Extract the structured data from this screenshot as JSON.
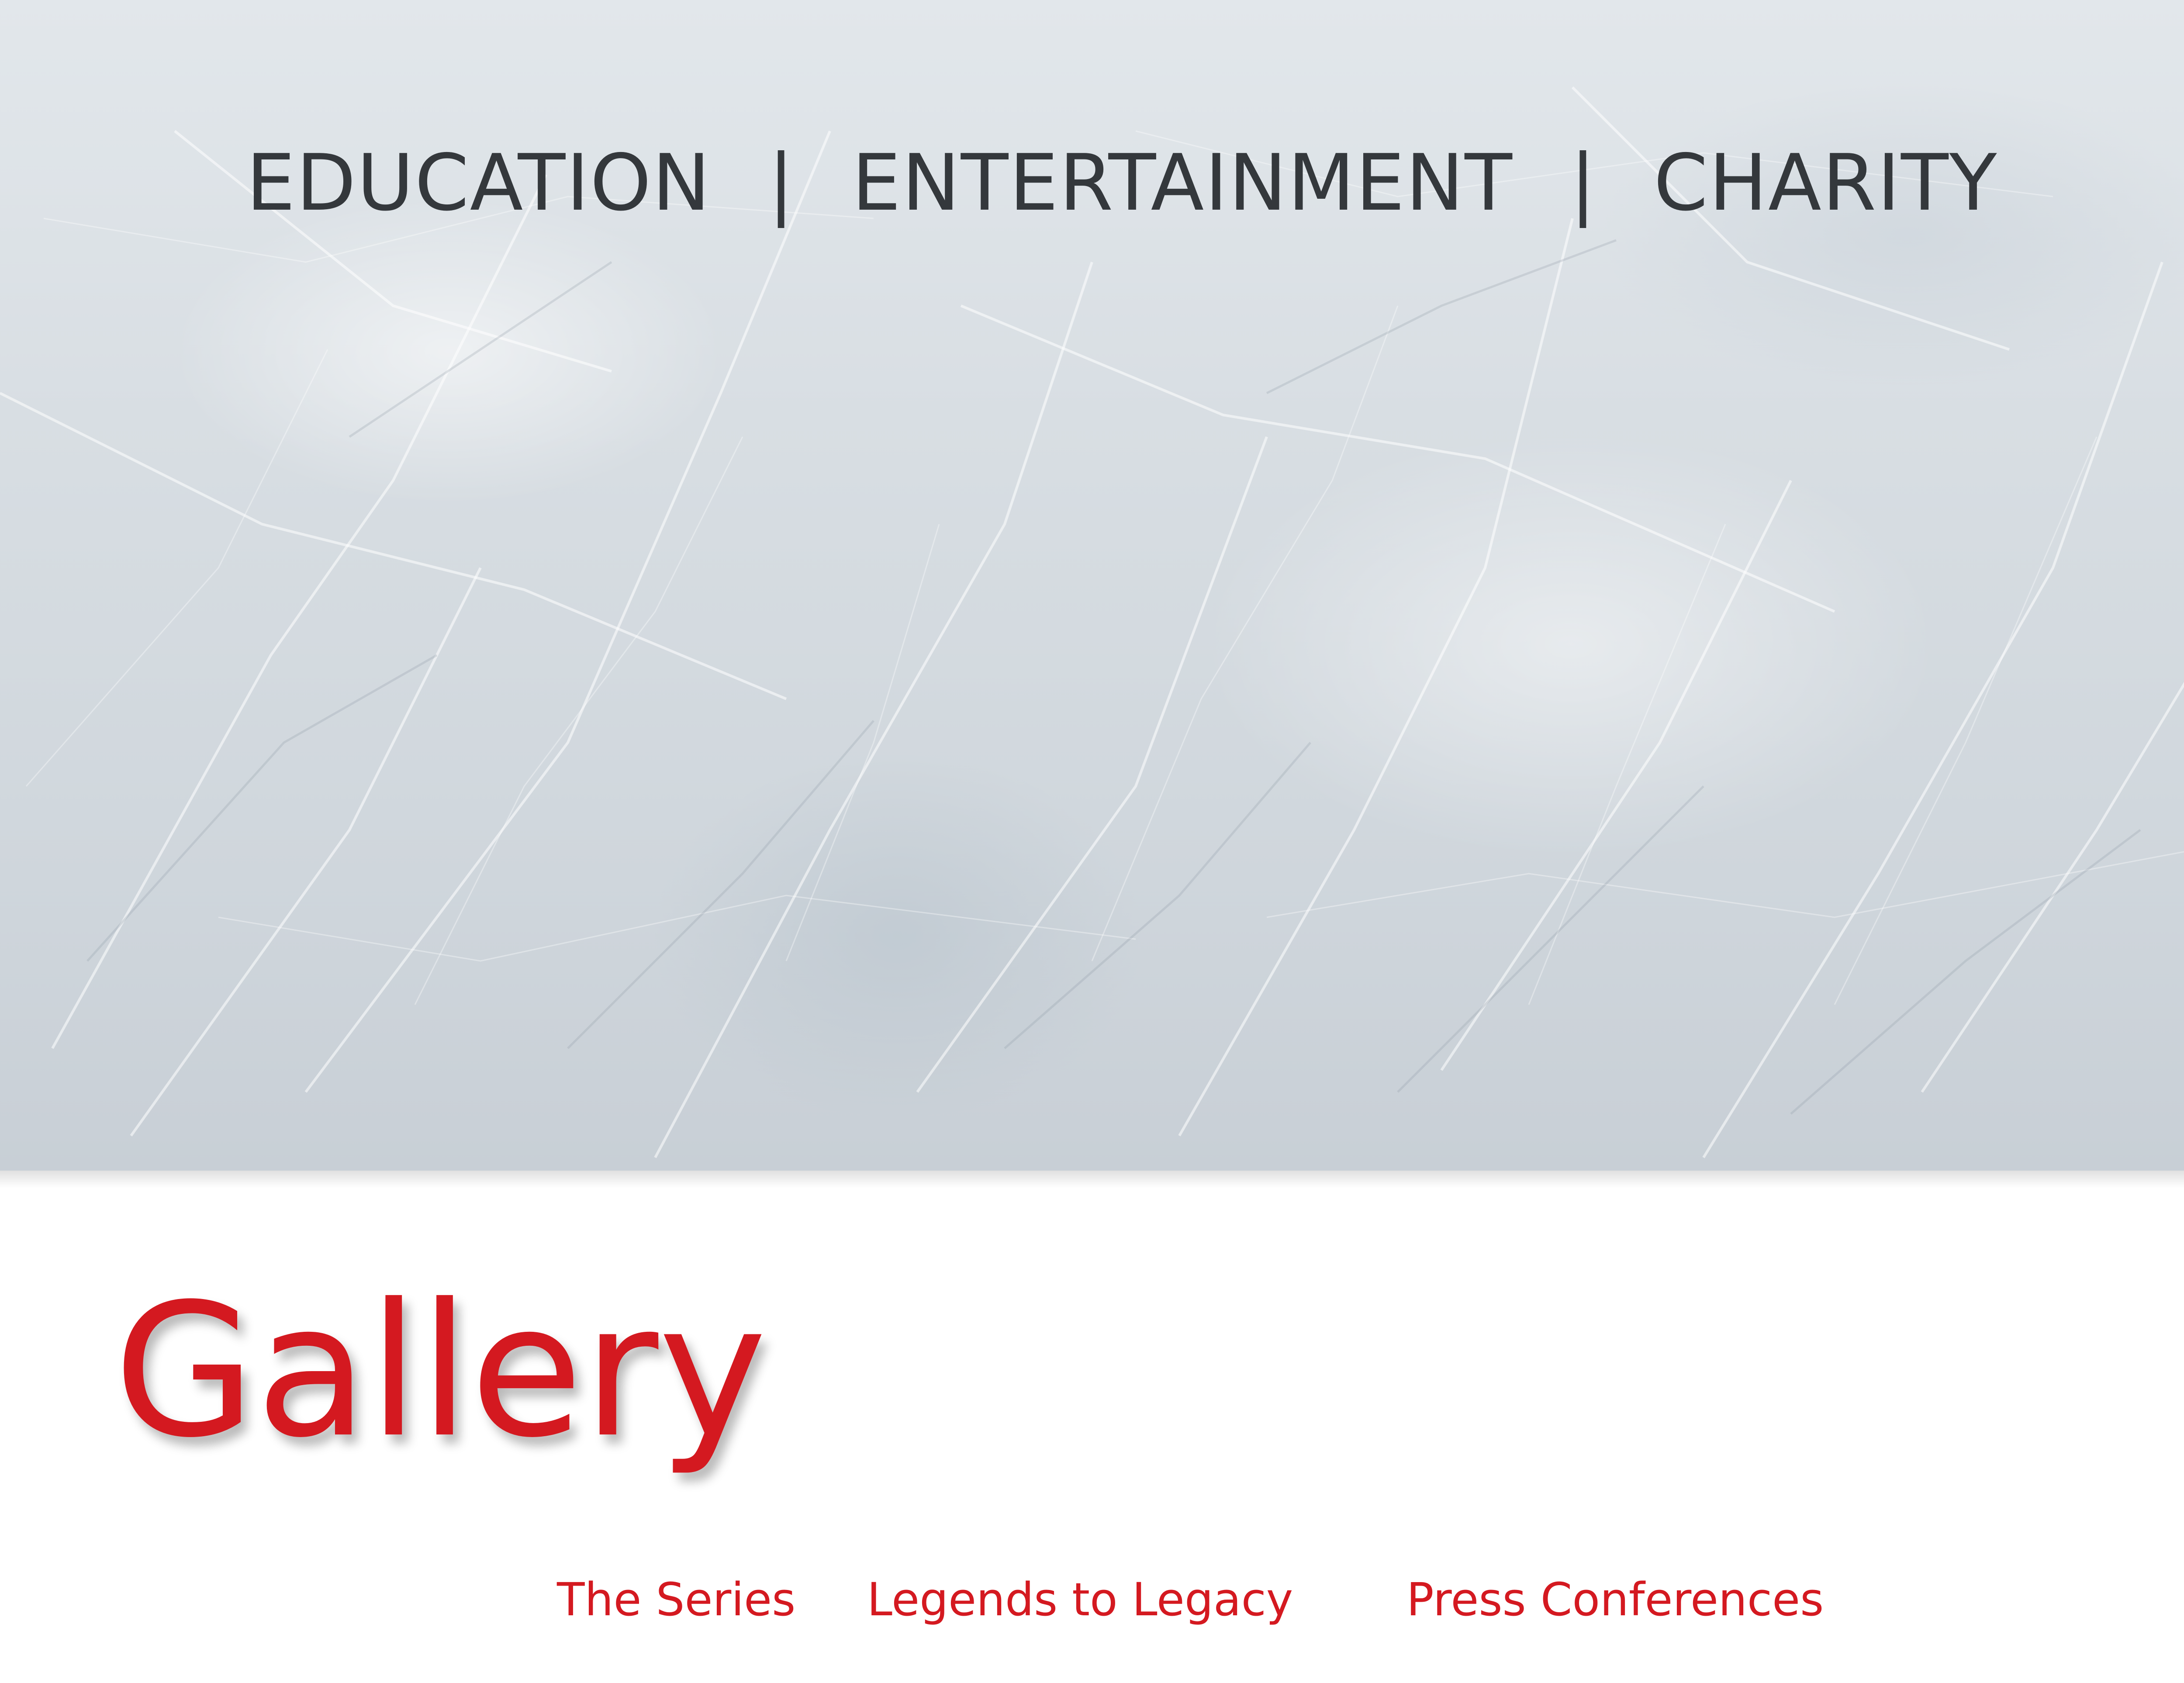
{
  "hero": {
    "tagline": {
      "items": [
        "EDUCATION",
        "ENTERTAINMENT",
        "CHARITY"
      ],
      "separator": "|"
    }
  },
  "gallery": {
    "title": "Gallery",
    "links": [
      {
        "label": "The Series"
      },
      {
        "label": "Legends to Legacy"
      },
      {
        "label": "Press Conferences"
      }
    ]
  },
  "colors": {
    "accent": "#d41920",
    "tagline_text": "#34383c",
    "ice_background": "#d7dde2"
  }
}
